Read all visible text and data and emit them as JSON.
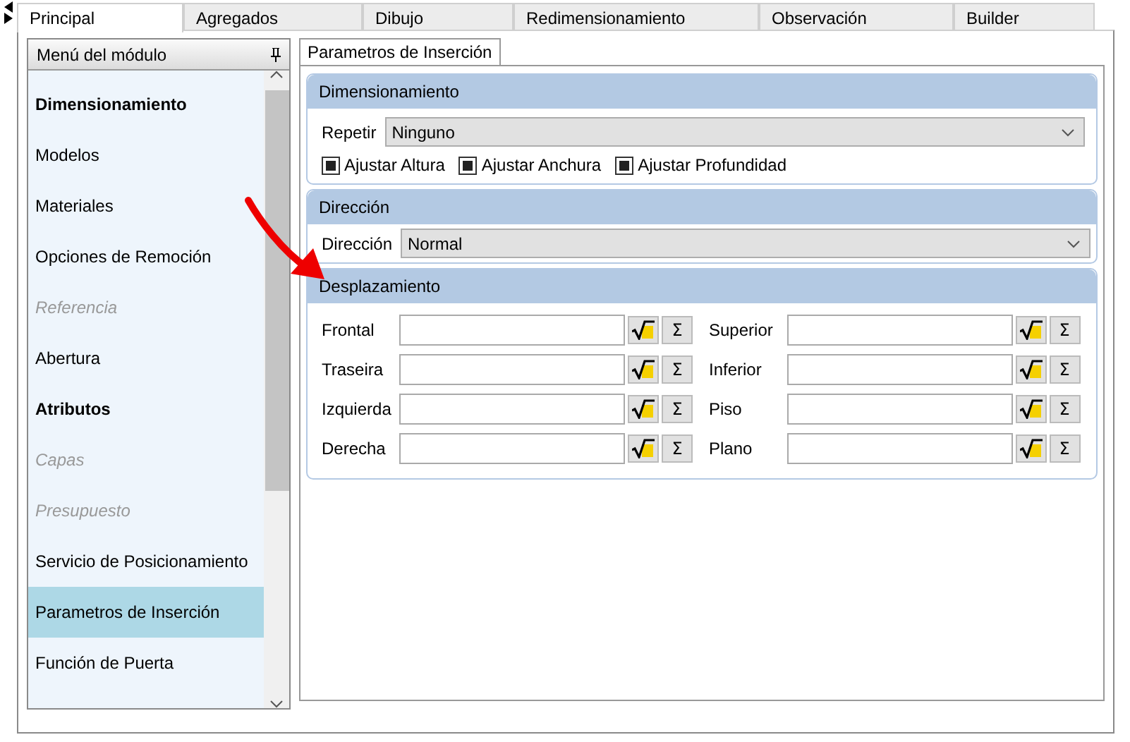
{
  "tabs": [
    {
      "label": "Principal",
      "selected": true
    },
    {
      "label": "Agregados",
      "selected": false
    },
    {
      "label": "Dibujo",
      "selected": false
    },
    {
      "label": "Redimensionamiento",
      "selected": false
    },
    {
      "label": "Observación",
      "selected": false
    },
    {
      "label": "Builder",
      "selected": false
    }
  ],
  "sidebar": {
    "title": "Menú del módulo",
    "items": [
      {
        "label": "Dimensionamiento",
        "kind": "header",
        "disabled": false,
        "selected": false
      },
      {
        "label": "Modelos",
        "kind": "item",
        "disabled": false,
        "selected": false
      },
      {
        "label": "Materiales",
        "kind": "item",
        "disabled": false,
        "selected": false
      },
      {
        "label": "Opciones de Remoción",
        "kind": "item",
        "disabled": false,
        "selected": false
      },
      {
        "label": "Referencia",
        "kind": "item",
        "disabled": true,
        "selected": false
      },
      {
        "label": "Abertura",
        "kind": "item",
        "disabled": false,
        "selected": false
      },
      {
        "label": "Atributos",
        "kind": "header",
        "disabled": false,
        "selected": false
      },
      {
        "label": "Capas",
        "kind": "item",
        "disabled": true,
        "selected": false
      },
      {
        "label": "Presupuesto",
        "kind": "item",
        "disabled": true,
        "selected": false
      },
      {
        "label": "Servicio de Posicionamiento",
        "kind": "item",
        "disabled": false,
        "selected": false
      },
      {
        "label": "Parametros de Inserción",
        "kind": "item",
        "disabled": false,
        "selected": true
      },
      {
        "label": "Función de Puerta",
        "kind": "item",
        "disabled": false,
        "selected": false
      }
    ]
  },
  "panel_tab": {
    "label": "Parametros de Inserción",
    "selected": true
  },
  "dimensionamiento": {
    "title": "Dimensionamiento",
    "repeat_label": "Repetir",
    "repeat_value": "Ninguno",
    "checkboxes": [
      {
        "label": "Ajustar Altura",
        "checked": true
      },
      {
        "label": "Ajustar Anchura",
        "checked": true
      },
      {
        "label": "Ajustar Profundidad",
        "checked": true
      }
    ]
  },
  "direccion": {
    "title": "Dirección",
    "label": "Dirección",
    "value": "Normal"
  },
  "desplazamiento": {
    "title": "Desplazamiento",
    "fields": [
      {
        "label": "Frontal",
        "sum": "Σ"
      },
      {
        "label": "Superior",
        "sum": "Σ"
      },
      {
        "label": "Traseira",
        "sum": "Σ"
      },
      {
        "label": "Inferior",
        "sum": "Σ"
      },
      {
        "label": "Izquierda",
        "sum": "Σ"
      },
      {
        "label": "Piso",
        "sum": "Σ"
      },
      {
        "label": "Derecha",
        "sum": "Σ"
      },
      {
        "label": "Plano",
        "sum": "Σ"
      }
    ]
  }
}
